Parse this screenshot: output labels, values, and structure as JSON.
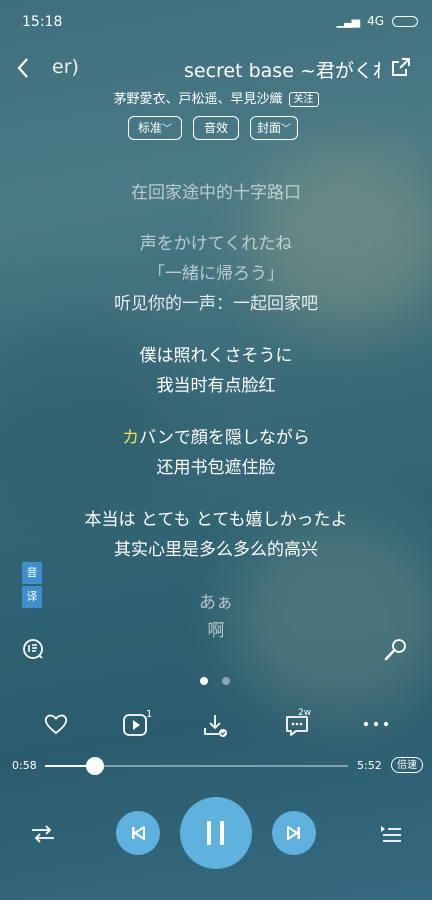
{
  "status_bar": {
    "time": "15:18",
    "network": "4G"
  },
  "header": {
    "prev_title": "er)",
    "title": "secret base ~君がくれ",
    "artists": "茅野愛衣、戸松遥、早見沙織",
    "follow_label": "关注"
  },
  "toolbar": {
    "quality_label": "标准",
    "effect_label": "音效",
    "cover_label": "封面"
  },
  "lyrics": [
    {
      "lines": [
        "在回家途中的十字路口"
      ]
    },
    {
      "lines": [
        "声をかけてくれたね",
        "「一緒に帰ろう」",
        "听见你的一声：一起回家吧"
      ]
    },
    {
      "lines": [
        "僕は照れくさそうに",
        "我当时有点脸红"
      ]
    },
    {
      "highlight": "カ",
      "rest": "バンで顔を隠しながら",
      "lines": [
        "还用书包遮住脸"
      ]
    },
    {
      "lines": [
        "本当は とても とても嬉しかったよ",
        "其实心里是多么多么的高兴"
      ]
    },
    {
      "lines": [
        "あぁ",
        "啊"
      ]
    }
  ],
  "side_badge": {
    "top": "音",
    "bottom": "译"
  },
  "pager": {
    "count": 2,
    "active": 0
  },
  "actions": {
    "mv_count": "1",
    "comment_count": "2w"
  },
  "progress": {
    "current": "0:58",
    "total": "5:52",
    "fraction": 0.165,
    "speed_label": "倍速"
  },
  "colors": {
    "accent": "#5fb1de",
    "highlight": "#f2df4a"
  }
}
